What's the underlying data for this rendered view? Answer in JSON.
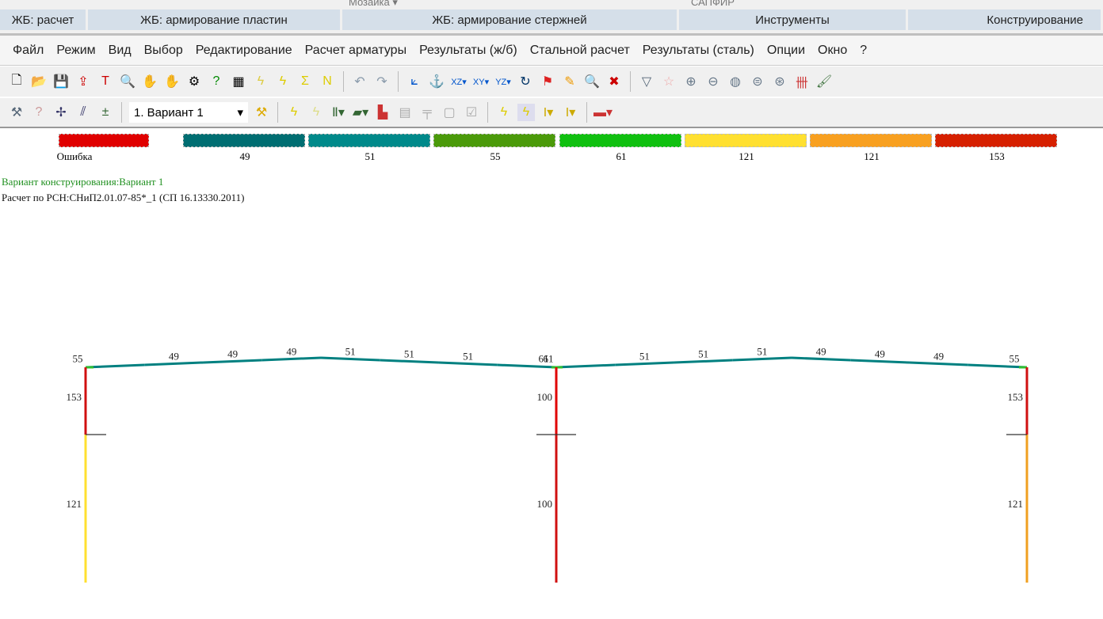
{
  "ribbon": {
    "groups": [
      "ЖБ: расчет",
      "ЖБ: армирование пластин",
      "ЖБ: армирование стержней",
      "Инструменты",
      "Конструирование"
    ],
    "top_labels": [
      "Мозаика ▾",
      "САПФИР"
    ]
  },
  "menu": [
    "Файл",
    "Режим",
    "Вид",
    "Выбор",
    "Редактирование",
    "Расчет арматуры",
    "Результаты (ж/б)",
    "Стальной расчет",
    "Результаты (сталь)",
    "Опции",
    "Окно",
    "?"
  ],
  "toolbar2": {
    "variant_select": "1. Вариант 1"
  },
  "legend": [
    {
      "label": "Ошибка",
      "color": "#e00000"
    },
    {
      "label": "49",
      "color": "#006e72"
    },
    {
      "label": "51",
      "color": "#00898a"
    },
    {
      "label": "55",
      "color": "#4b9a0a"
    },
    {
      "label": "61",
      "color": "#10c010"
    },
    {
      "label": "121",
      "color": "#ffe030"
    },
    {
      "label": "121",
      "color": "#f8a020"
    },
    {
      "label": "153",
      "color": "#d62000"
    }
  ],
  "info": {
    "variant": "Вариант конструирования:Вариант 1",
    "code": "Расчет по РСН:СНиП2.01.07-85*_1 (СП 16.13330.2011)"
  },
  "colors": {
    "error": "#e00000",
    "teal": "#008080",
    "green": "#30c030",
    "yellow": "#ffe030",
    "orange": "#f0a020",
    "red": "#d01010"
  },
  "frame": {
    "rafter_left": [
      "55",
      "49",
      "49",
      "49",
      "51",
      "51",
      "51",
      "61"
    ],
    "rafter_right": [
      "61",
      "51",
      "51",
      "51",
      "49",
      "49",
      "49",
      "55"
    ],
    "columns": [
      {
        "upper": "153",
        "lower": "121",
        "lower_color": "yellow"
      },
      {
        "upper": "100",
        "lower": "100",
        "lower_color": "red"
      },
      {
        "upper": "153",
        "lower": "121",
        "lower_color": "orange"
      }
    ]
  }
}
